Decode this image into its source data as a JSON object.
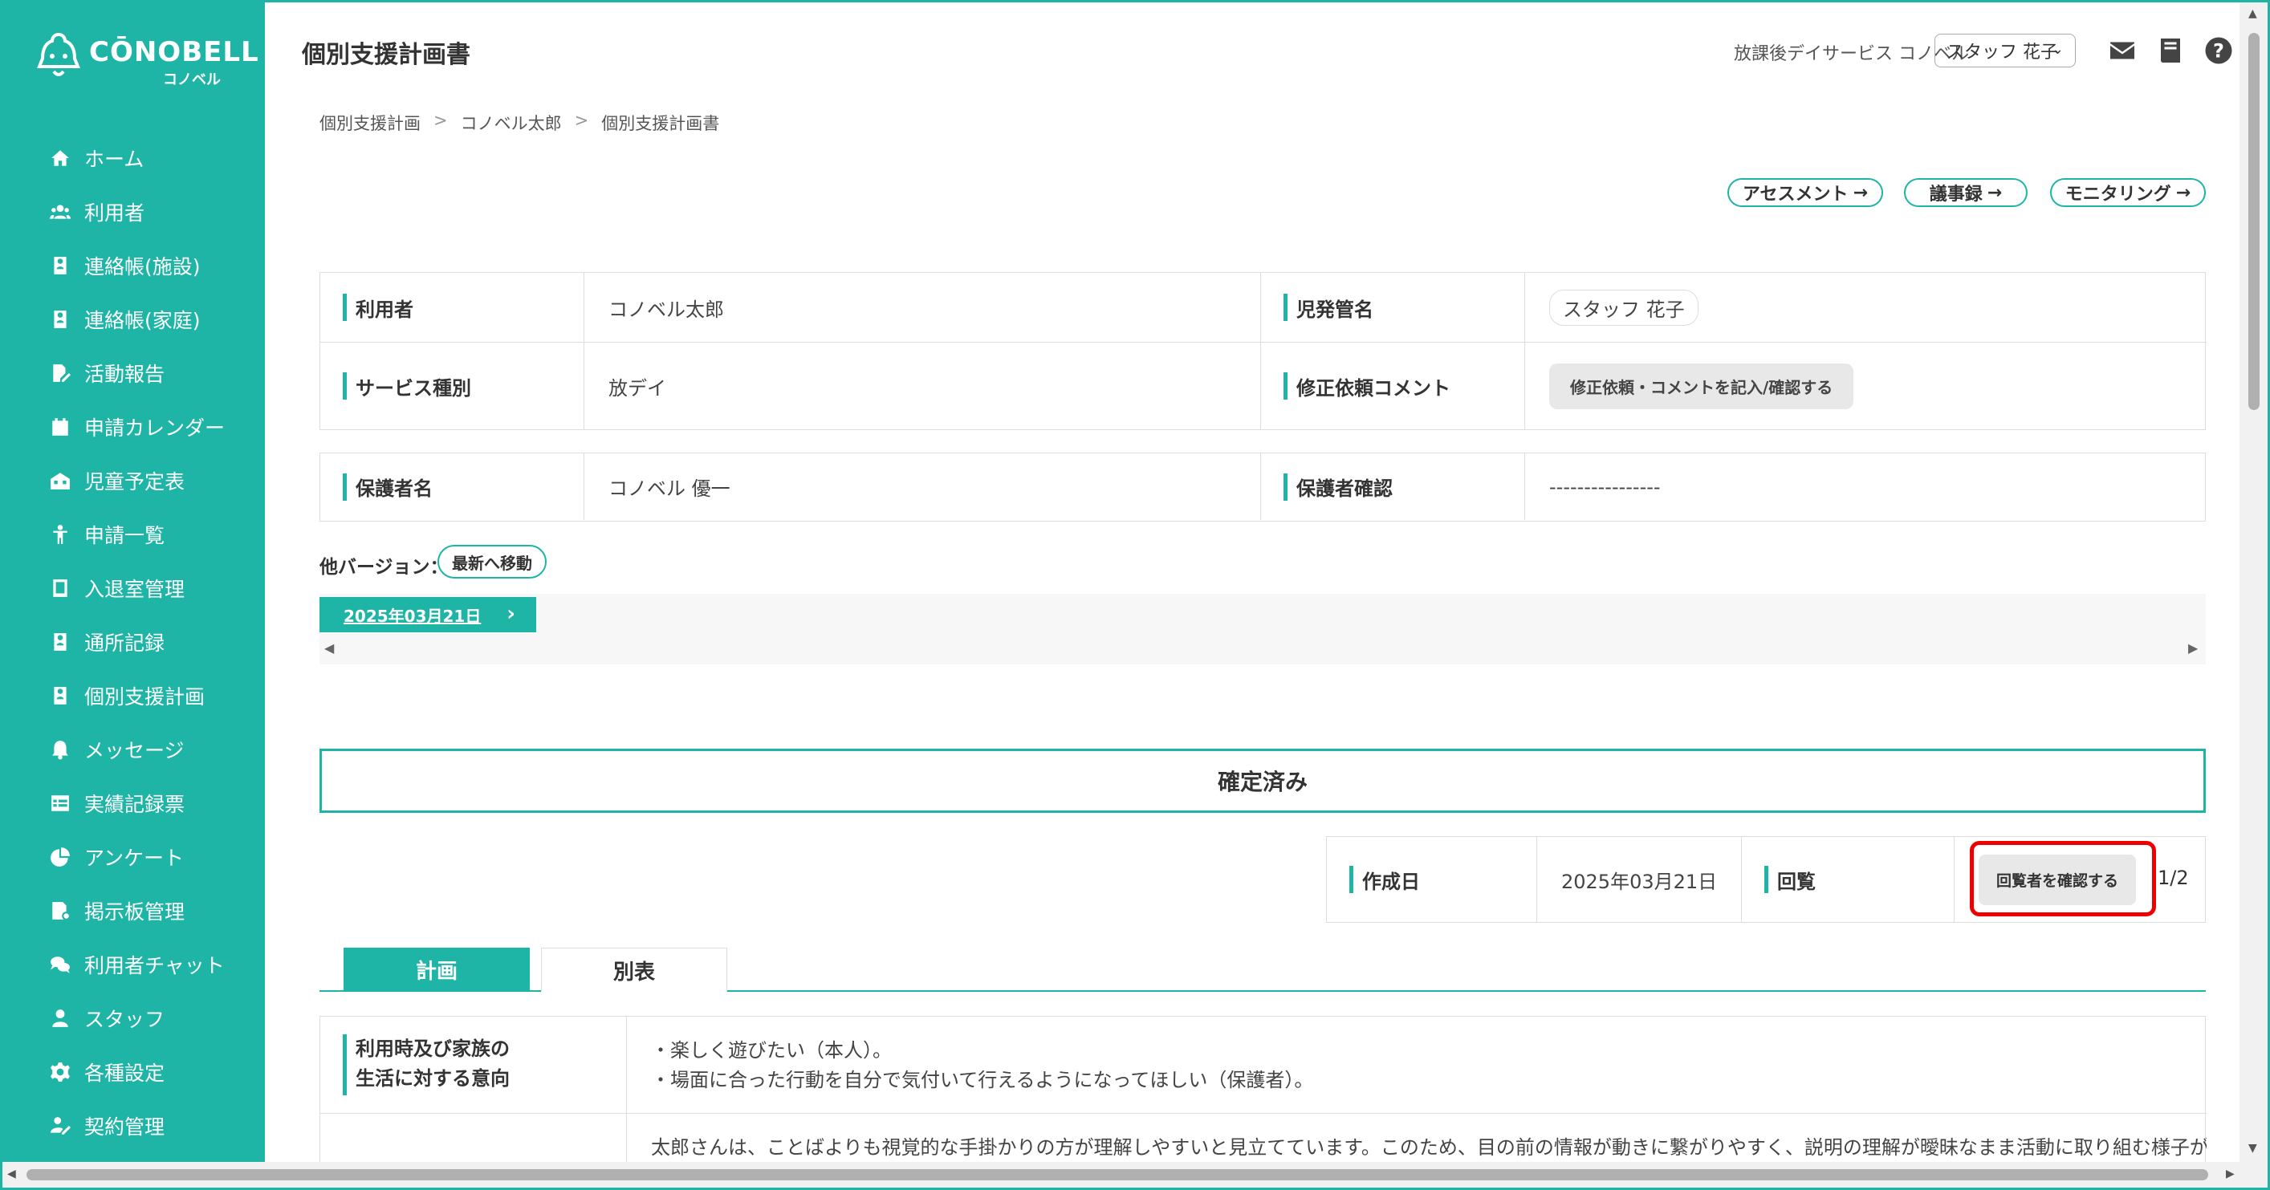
{
  "app": {
    "logo_text": "CŌNOBELL",
    "logo_sub": "コノベル"
  },
  "sidebar": {
    "items": [
      {
        "label": "ホーム",
        "icon": "home-icon"
      },
      {
        "label": "利用者",
        "icon": "users-icon"
      },
      {
        "label": "連絡帳(施設)",
        "icon": "contact-book-icon"
      },
      {
        "label": "連絡帳(家庭)",
        "icon": "contact-book-icon"
      },
      {
        "label": "活動報告",
        "icon": "report-icon"
      },
      {
        "label": "申請カレンダー",
        "icon": "calendar-icon"
      },
      {
        "label": "児童予定表",
        "icon": "schedule-icon"
      },
      {
        "label": "申請一覧",
        "icon": "child-icon"
      },
      {
        "label": "入退室管理",
        "icon": "tablet-icon"
      },
      {
        "label": "通所記録",
        "icon": "contact-book-icon"
      },
      {
        "label": "個別支援計画",
        "icon": "contact-book-icon"
      },
      {
        "label": "メッセージ",
        "icon": "bell-icon"
      },
      {
        "label": "実績記録票",
        "icon": "table-icon"
      },
      {
        "label": "アンケート",
        "icon": "pie-chart-icon"
      },
      {
        "label": "掲示板管理",
        "icon": "board-icon"
      },
      {
        "label": "利用者チャット",
        "icon": "chat-icon"
      },
      {
        "label": "スタッフ",
        "icon": "staff-icon"
      },
      {
        "label": "各種設定",
        "icon": "gear-icon"
      },
      {
        "label": "契約管理",
        "icon": "contract-icon"
      }
    ]
  },
  "header": {
    "title": "個別支援計画書",
    "facility": "放課後デイサービス コノベル",
    "staff_name": "スタッフ 花子"
  },
  "breadcrumb": [
    "個別支援計画",
    "コノベル太郎",
    "個別支援計画書"
  ],
  "links": {
    "assessment": "アセスメント",
    "minutes": "議事録",
    "monitoring": "モニタリング"
  },
  "info": {
    "user_label": "利用者",
    "user_value": "コノベル太郎",
    "manager_label": "児発管名",
    "manager_value": "スタッフ 花子",
    "service_label": "サービス種別",
    "service_value": "放デイ",
    "comment_label": "修正依頼コメント",
    "comment_button": "修正依頼・コメントを記入/確認する",
    "guardian_label": "保護者名",
    "guardian_value": "コノベル 優一",
    "guardian_confirm_label": "保護者確認",
    "guardian_confirm_value": "----------------"
  },
  "version": {
    "label": "他バージョン：",
    "latest_button": "最新へ移動",
    "current_date": "2025年03月21日"
  },
  "status": "確定済み",
  "dates": {
    "created_label": "作成日",
    "created_value": "2025年03月21日",
    "circulation_label": "回覧",
    "confirm_button": "回覧者を確認する",
    "page_count": "1/2"
  },
  "tabs": {
    "plan": "計画",
    "appendix": "別表"
  },
  "plan": {
    "intent_label_1": "利用時及び家族の",
    "intent_label_2": "生活に対する意向",
    "intent_line_1": "・楽しく遊びたい（本人）。",
    "intent_line_2": "・場面に合った行動を自分で気付いて行えるようになってほしい（保護者）。",
    "assessment_text": "太郎さんは、ことばよりも視覚的な手掛かりの方が理解しやすいと見立てています。このため、目の前の情報が動きに繋がりやすく、説明の理解が曖昧なまま活動に取り組む様子が見られ、集"
  },
  "colors": {
    "accent": "#1fb5a6",
    "highlight": "#e00000"
  }
}
